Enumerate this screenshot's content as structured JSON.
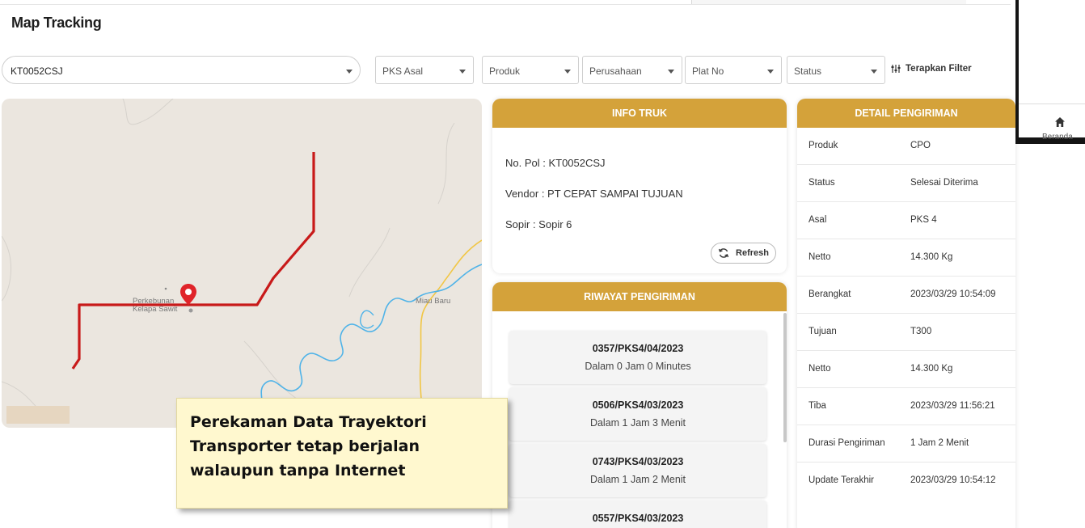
{
  "header": {
    "title": "Map Tracking"
  },
  "filters": {
    "vehicle_select": "KT0052CSJ",
    "pks_asal": "PKS Asal",
    "produk": "Produk",
    "perusahaan": "Perusahaan",
    "plat_no": "Plat No",
    "status": "Status",
    "apply_label": "Terapkan Filter"
  },
  "map": {
    "place_label_1": "Perkebunan",
    "place_label_2": "Kelapa Sawit",
    "place_label_3": "Miau Baru",
    "route_color": "#c81a1a",
    "river_color": "#4fb3e8",
    "road_color": "#f1c644"
  },
  "info_truk": {
    "title": "INFO TRUK",
    "no_pol": "No. Pol : KT0052CSJ",
    "vendor": "Vendor :  PT CEPAT SAMPAI TUJUAN",
    "sopir": "Sopir :  Sopir 6",
    "refresh_label": "Refresh"
  },
  "riwayat": {
    "title": "RIWAYAT PENGIRIMAN",
    "items": [
      {
        "no": "0357/PKS4/04/2023",
        "duration": "Dalam 0 Jam 0 Minutes"
      },
      {
        "no": "0506/PKS4/03/2023",
        "duration": "Dalam 1 Jam 3 Menit"
      },
      {
        "no": "0743/PKS4/03/2023",
        "duration": "Dalam 1 Jam 2 Menit"
      },
      {
        "no": "0557/PKS4/03/2023",
        "duration": ""
      }
    ]
  },
  "detail": {
    "title": "DETAIL PENGIRIMAN",
    "rows": [
      {
        "label": "Produk",
        "value": "CPO"
      },
      {
        "label": "Status",
        "value": "Selesai Diterima"
      },
      {
        "label": "Asal",
        "value": "PKS 4"
      },
      {
        "label": "Netto",
        "value": "14.300 Kg"
      },
      {
        "label": "Berangkat",
        "value": "2023/03/29 10:54:09"
      },
      {
        "label": "Tujuan",
        "value": "T300"
      },
      {
        "label": "Netto",
        "value": "14.300 Kg"
      },
      {
        "label": "Tiba",
        "value": "2023/03/29 11:56:21"
      },
      {
        "label": "Durasi Pengiriman",
        "value": "1 Jam 2 Menit"
      },
      {
        "label": "Update Terakhir",
        "value": "2023/03/29 10:54:12"
      }
    ]
  },
  "mobile_nav": {
    "home_label": "Beranda"
  },
  "callout": {
    "line1": "Perekaman Data Trayektori",
    "line2": "Transporter tetap berjalan",
    "line3": "walaupun tanpa Internet"
  },
  "colors": {
    "accent": "#d4a23a"
  }
}
